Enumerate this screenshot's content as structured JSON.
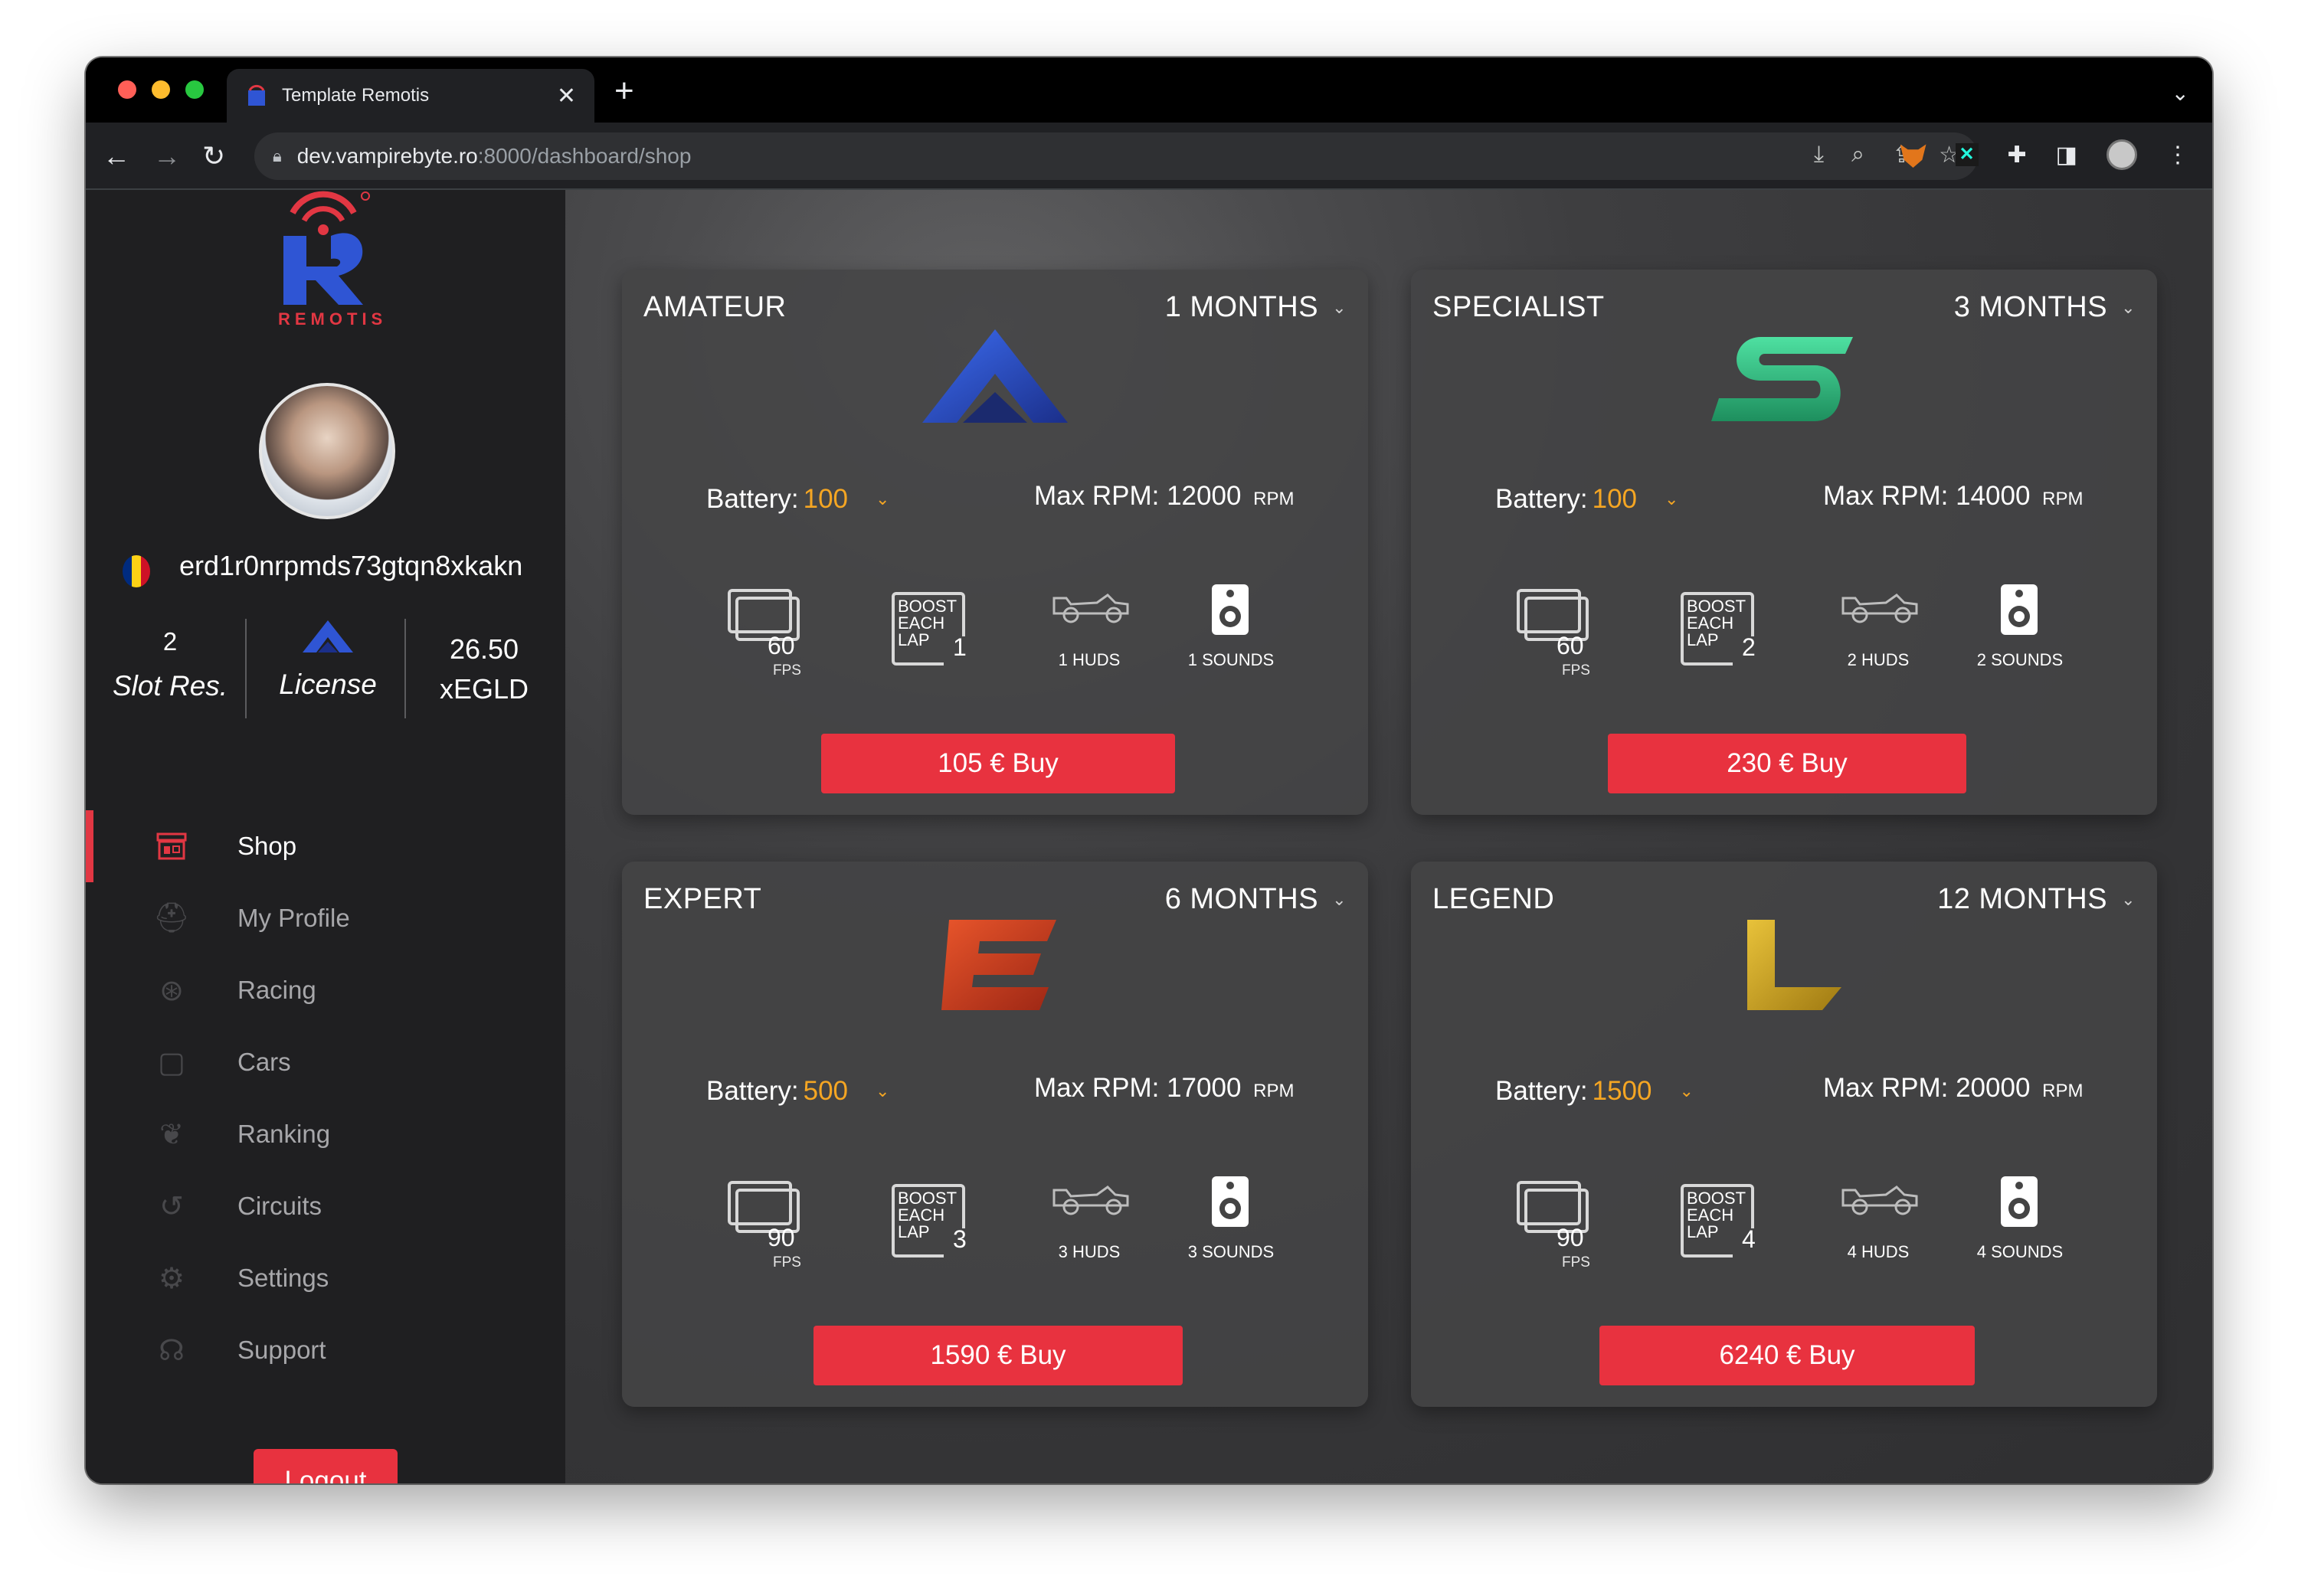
{
  "browser": {
    "tab_title": "Template Remotis",
    "tab_close": "✕",
    "new_tab": "+",
    "url_host": "dev.vampirebyte.ro",
    "url_path": ":8000/dashboard/shop"
  },
  "sidebar": {
    "logo_text": "REMOTIS",
    "username": "erd1r0nrpmds73gtqn8xkakn",
    "stats": {
      "slot_value": "2",
      "slot_label": "Slot Res.",
      "license_label": "License",
      "balance_value": "26.50",
      "balance_unit": "xEGLD"
    },
    "menu": [
      {
        "label": "Shop",
        "icon": "shop-icon",
        "active": true
      },
      {
        "label": "My Profile",
        "icon": "helmet-icon"
      },
      {
        "label": "Racing",
        "icon": "steering-wheel-icon"
      },
      {
        "label": "Cars",
        "icon": "car-icon"
      },
      {
        "label": "Ranking",
        "icon": "laurel-icon"
      },
      {
        "label": "Circuits",
        "icon": "circuit-icon"
      },
      {
        "label": "Settings",
        "icon": "gear-icon"
      },
      {
        "label": "Support",
        "icon": "headset-icon"
      }
    ],
    "logout_label": "Logout"
  },
  "shop": {
    "battery_label": "Battery:",
    "rpm_label": "Max RPM:",
    "rpm_unit": "RPM",
    "fps_label": "FPS",
    "boost_text": "BOOST\nEACH\nLAP",
    "cards": [
      {
        "title": "AMATEUR",
        "period": "1 MONTHS",
        "battery": "100",
        "rpm": "12000",
        "fps": "60",
        "boost": "1",
        "huds": "1 HUDS",
        "sounds": "1 SOUNDS",
        "buy": "105 € Buy",
        "logo_color": "#2f55d4"
      },
      {
        "title": "SPECIALIST",
        "period": "3 MONTHS",
        "battery": "100",
        "rpm": "14000",
        "fps": "60",
        "boost": "2",
        "huds": "2 HUDS",
        "sounds": "2 SOUNDS",
        "buy": "230 € Buy",
        "logo_color": "#3ecf8e"
      },
      {
        "title": "EXPERT",
        "period": "6 MONTHS",
        "battery": "500",
        "rpm": "17000",
        "fps": "90",
        "boost": "3",
        "huds": "3 HUDS",
        "sounds": "3 SOUNDS",
        "buy": "1590 € Buy",
        "logo_color": "#d2421d"
      },
      {
        "title": "LEGEND",
        "period": "12 MONTHS",
        "battery": "1500",
        "rpm": "20000",
        "fps": "90",
        "boost": "4",
        "huds": "4 HUDS",
        "sounds": "4 SOUNDS",
        "buy": "6240 € Buy",
        "logo_color": "#d4a61e"
      }
    ]
  },
  "colors": {
    "accent": "#e8323f",
    "battery_value": "#f5a623",
    "sidebar_bg": "#1f1f21"
  }
}
